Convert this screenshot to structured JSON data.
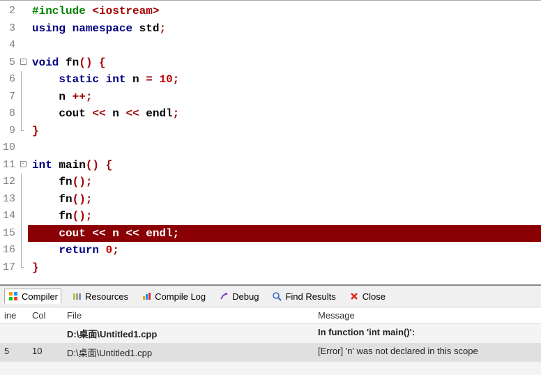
{
  "lines": [
    "2",
    "3",
    "4",
    "5",
    "6",
    "7",
    "8",
    "9",
    "10",
    "11",
    "12",
    "13",
    "14",
    "15",
    "16",
    "17"
  ],
  "code": {
    "l2": {
      "pre": "#include ",
      "ang": "<iostream>"
    },
    "l3": {
      "kw1": "using",
      "sp1": " ",
      "kw2": "namespace",
      "sp2": " ",
      "id": "std",
      "p": ";"
    },
    "l5": {
      "kw": "void",
      "sp": " ",
      "id": "fn",
      "par": "()",
      "sp2": " ",
      "br": "{"
    },
    "l6": {
      "ind": "    ",
      "kw1": "static",
      "sp1": " ",
      "kw2": "int",
      "sp2": " ",
      "id": "n ",
      "op": "=",
      "sp3": " ",
      "num": "10",
      "p": ";"
    },
    "l7": {
      "ind": "    ",
      "id": "n ",
      "op": "++",
      "p": ";"
    },
    "l8": {
      "ind": "    ",
      "id": "cout ",
      "op1": "<<",
      "sp1": " ",
      "id2": "n ",
      "op2": "<<",
      "sp2": " ",
      "id3": "endl",
      "p": ";"
    },
    "l9": {
      "br": "}"
    },
    "l11": {
      "kw": "int",
      "sp": " ",
      "id": "main",
      "par": "()",
      "sp2": " ",
      "br": "{"
    },
    "l12": {
      "ind": "    ",
      "id": "fn",
      "par": "()",
      "p": ";"
    },
    "l13": {
      "ind": "    ",
      "id": "fn",
      "par": "()",
      "p": ";"
    },
    "l14": {
      "ind": "    ",
      "id": "fn",
      "par": "()",
      "p": ";"
    },
    "l15": {
      "txt": "    cout << n << endl;"
    },
    "l16": {
      "ind": "    ",
      "kw": "return",
      "sp": " ",
      "num": "0",
      "p": ";"
    },
    "l17": {
      "br": "}"
    }
  },
  "tabs": {
    "compiler": "Compiler",
    "resources": "Resources",
    "compilelog": "Compile Log",
    "debug": "Debug",
    "findresults": "Find Results",
    "close": "Close"
  },
  "headers": {
    "line": "ine",
    "col": "Col",
    "file": "File",
    "msg": "Message"
  },
  "errors": [
    {
      "line": "",
      "col": "",
      "file": "D:\\桌面\\Untitled1.cpp",
      "msg": "In function 'int main()':",
      "bold": true
    },
    {
      "line": "5",
      "col": "10",
      "file": "D:\\桌面\\Untitled1.cpp",
      "msg": "[Error] 'n' was not declared in this scope",
      "bold": false
    }
  ]
}
